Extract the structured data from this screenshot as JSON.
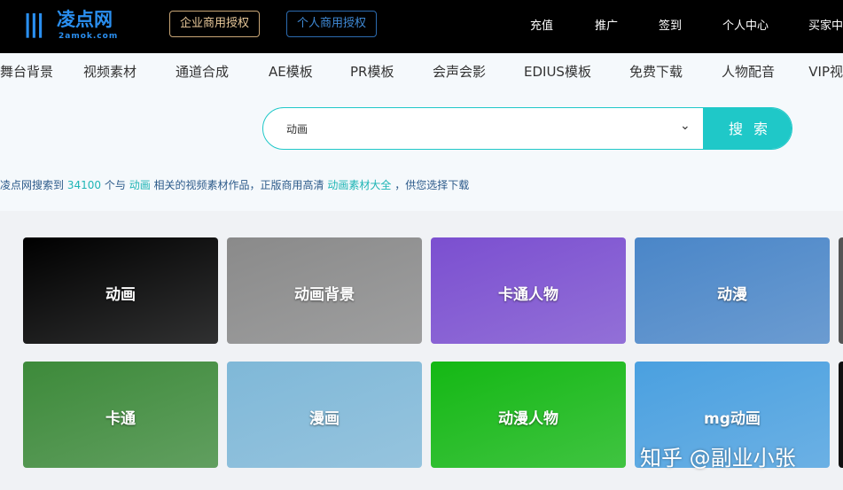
{
  "header": {
    "logo_name": "凌点网",
    "logo_domain": "2amok.com",
    "license_enterprise": "企业商用授权",
    "license_personal": "个人商用授权",
    "nav": [
      "充值",
      "推广",
      "签到",
      "个人中心",
      "买家中"
    ]
  },
  "categories": [
    "舞台背景",
    "视频素材",
    "通道合成",
    "AE模板",
    "PR模板",
    "会声会影",
    "EDIUS模板",
    "免费下载",
    "人物配音",
    "VIP视"
  ],
  "search": {
    "value": "动画",
    "button": "搜索"
  },
  "result": {
    "prefix": "凌点网搜索到",
    "count": "34100",
    "mid1": "个与",
    "keyword": "动画",
    "mid2": "相关的视频素材作品，正版商用高清",
    "link": "动画素材大全",
    "suffix": "，供您选择下载"
  },
  "cards": [
    {
      "label": "动画",
      "color": "#000000"
    },
    {
      "label": "动画背景",
      "color": "#8a8a8a"
    },
    {
      "label": "卡通人物",
      "color": "#7b4fd0"
    },
    {
      "label": "动漫",
      "color": "#4a86c8"
    },
    {
      "label": "卡通",
      "color": "#3d8a3a"
    },
    {
      "label": "漫画",
      "color": "#7fb8d8"
    },
    {
      "label": "动漫人物",
      "color": "#14b814"
    },
    {
      "label": "mg动画",
      "color": "#4aa0e0"
    }
  ],
  "watermark": "知乎 @副业小张"
}
